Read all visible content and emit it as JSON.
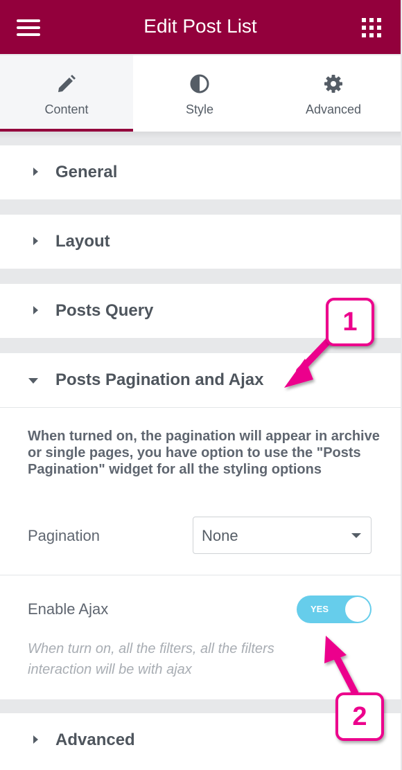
{
  "header": {
    "title": "Edit Post List",
    "menu_icon": "hamburger-menu-icon",
    "apps_icon": "grid-apps-icon",
    "color": "#93003c"
  },
  "tabs": [
    {
      "label": "Content",
      "icon": "pencil-icon",
      "active": true
    },
    {
      "label": "Style",
      "icon": "contrast-circle-icon",
      "active": false
    },
    {
      "label": "Advanced",
      "icon": "gear-icon",
      "active": false
    }
  ],
  "sections": {
    "general": "General",
    "layout": "Layout",
    "posts_query": "Posts Query",
    "pagination_ajax": "Posts Pagination and Ajax",
    "advanced": "Advanced"
  },
  "pagination_panel": {
    "description": "When turned on, the pagination will appear in archive or single pages, you have option to use the \"Posts Pagination\" widget for all the styling options",
    "pagination_label": "Pagination",
    "pagination_value": "None",
    "enable_ajax_label": "Enable Ajax",
    "enable_ajax_toggle": "YES",
    "enable_ajax_on": true,
    "ajax_note": "When turn on, all the filters, all the filters interaction will be with ajax"
  },
  "annotations": {
    "badge_1": "1",
    "badge_2": "2",
    "color": "#ec008c"
  }
}
